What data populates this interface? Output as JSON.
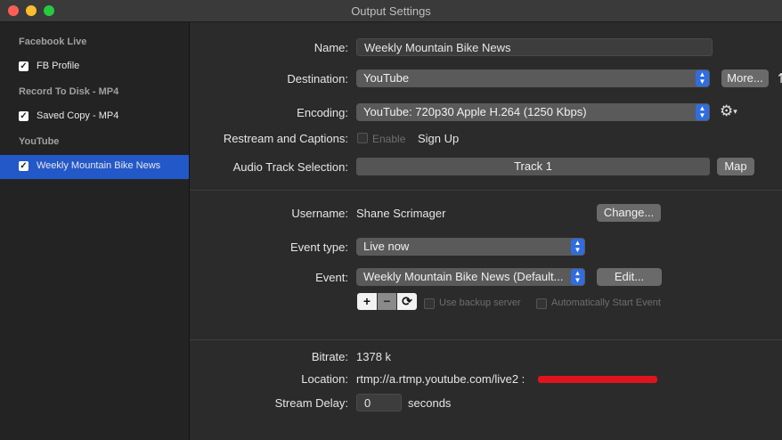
{
  "window": {
    "title": "Output Settings"
  },
  "sidebar": {
    "groups": [
      {
        "header": "Facebook Live",
        "item": "FB Profile"
      },
      {
        "header": "Record To Disk - MP4",
        "item": "Saved Copy - MP4"
      },
      {
        "header": "YouTube",
        "item": "Weekly Mountain Bike News"
      }
    ]
  },
  "form": {
    "name_label": "Name:",
    "name_value": "Weekly Mountain Bike News",
    "destination_label": "Destination:",
    "destination_value": "YouTube",
    "more_button": "More...",
    "encoding_label": "Encoding:",
    "encoding_value": "YouTube: 720p30 Apple H.264 (1250 Kbps)",
    "restream_label": "Restream and Captions:",
    "enable_label": "Enable",
    "signup_link": "Sign Up",
    "audio_label": "Audio Track Selection:",
    "audio_value": "Track 1",
    "map_button": "Map"
  },
  "account": {
    "username_label": "Username:",
    "username_value": "Shane Scrimager",
    "change_button": "Change...",
    "event_type_label": "Event type:",
    "event_type_value": "Live now",
    "event_label": "Event:",
    "event_value": "Weekly Mountain Bike News (Default...",
    "edit_button": "Edit...",
    "add_symbol": "+",
    "remove_symbol": "−",
    "refresh_symbol": "⟳",
    "backup_label": "Use backup server",
    "autostart_label": "Automatically Start Event"
  },
  "stream": {
    "bitrate_label": "Bitrate:",
    "bitrate_value": "1378 k",
    "location_label": "Location:",
    "location_value": "rtmp://a.rtmp.youtube.com/live2 :",
    "delay_label": "Stream Delay:",
    "delay_value": "0",
    "delay_unit": "seconds"
  },
  "colors": {
    "accent": "#2f6de0",
    "selection": "#2358c8",
    "redaction": "#e0141c"
  }
}
